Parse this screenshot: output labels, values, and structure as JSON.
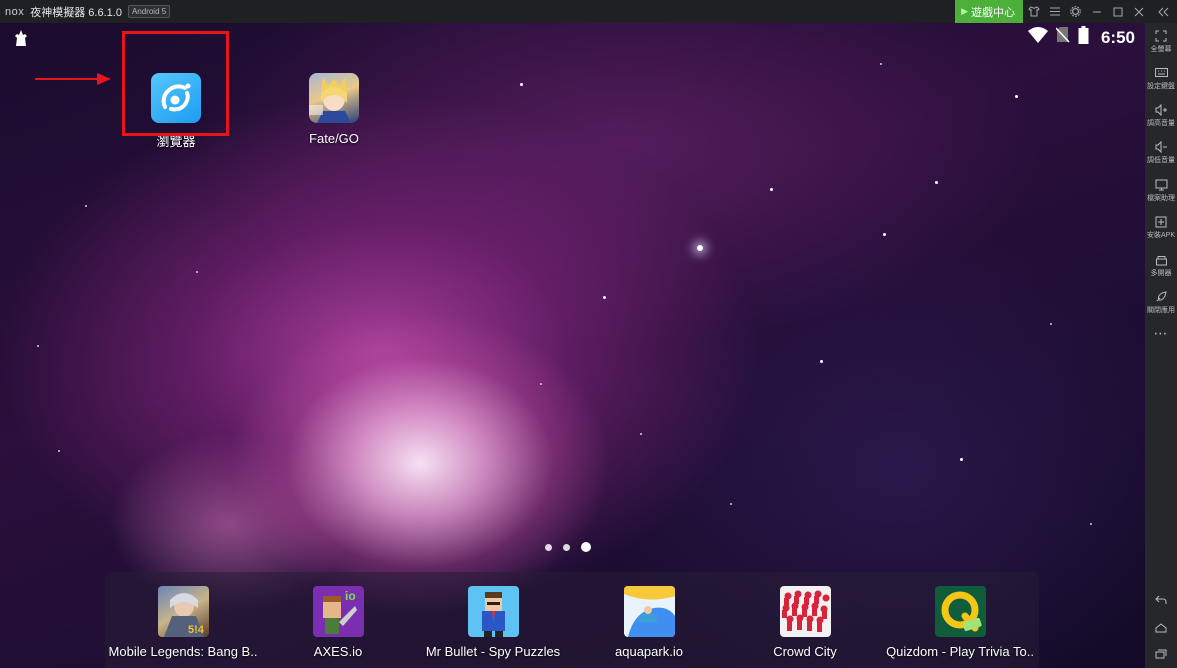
{
  "titlebar": {
    "logo": "nox",
    "title": "夜神模擬器 6.6.1.0",
    "badge": "Android 5",
    "game_center": "遊戲中心",
    "icons": [
      "shirt-icon",
      "menu-icon",
      "gear-icon",
      "minimize-icon",
      "maximize-icon",
      "close-icon",
      "collapse-sidebar-icon"
    ]
  },
  "statusbar": {
    "time": "6:50",
    "icons": [
      "nox-status-icon",
      "wifi-icon",
      "no-sim-icon",
      "battery-icon"
    ]
  },
  "desktop": {
    "apps": [
      {
        "label": "瀏覽器",
        "icon": "browser-icon",
        "highlighted": true
      },
      {
        "label": "Fate/GO",
        "icon": "fate-go-icon"
      }
    ],
    "page_dots": 3,
    "active_page": 3
  },
  "dock": {
    "apps": [
      {
        "label": "Mobile Legends: Bang B..",
        "icon": "mobile-legends-icon"
      },
      {
        "label": "AXES.io",
        "icon": "axes-io-icon"
      },
      {
        "label": "Mr Bullet - Spy Puzzles",
        "icon": "mr-bullet-icon"
      },
      {
        "label": "aquapark.io",
        "icon": "aquapark-icon"
      },
      {
        "label": "Crowd City",
        "icon": "crowd-city-icon"
      },
      {
        "label": "Quizdom - Play Trivia To..",
        "icon": "quizdom-icon"
      }
    ]
  },
  "sidebar": {
    "items": [
      {
        "label": "全螢幕",
        "icon": "fullscreen-icon"
      },
      {
        "label": "設定鍵盤",
        "icon": "keyboard-icon"
      },
      {
        "label": "調高音量",
        "icon": "volume-up-icon"
      },
      {
        "label": "調低音量",
        "icon": "volume-down-icon"
      },
      {
        "label": "檔案助理",
        "icon": "file-assistant-icon"
      },
      {
        "label": "安裝APK",
        "icon": "install-apk-icon"
      },
      {
        "label": "多開器",
        "icon": "multi-instance-icon"
      },
      {
        "label": "關閉應用",
        "icon": "close-app-icon"
      }
    ],
    "more": "⋯",
    "nav": [
      "back-icon",
      "home-icon",
      "recents-icon"
    ]
  },
  "colors": {
    "highlight": "#e8141b",
    "game_center": "#4caf3a",
    "titlebar": "#1e2024",
    "sidebar": "#25272b"
  }
}
